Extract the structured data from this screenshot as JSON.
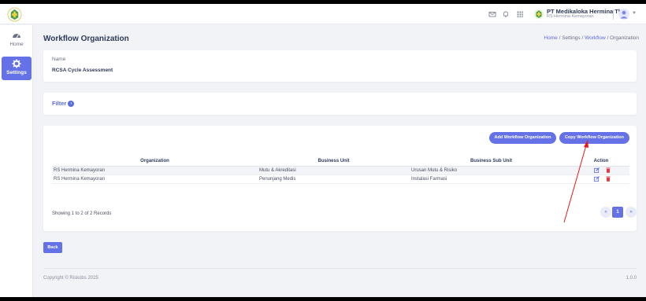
{
  "topbar": {
    "company_name": "PT Medikaloka Hermina Tbk",
    "company_sub": "RS Hermina Kemayoran",
    "icons": [
      "mail-icon",
      "bell-icon",
      "apps-grid-icon",
      "user-avatar-icon"
    ]
  },
  "sidebar": {
    "items": [
      {
        "label": "Home",
        "icon": "dashboard-icon"
      },
      {
        "label": "Settings",
        "icon": "gear-icon",
        "active": true
      }
    ]
  },
  "page": {
    "title": "Workflow Organization",
    "breadcrumb": {
      "home": "Home",
      "sep1": " / ",
      "settings": "Settings",
      "sep2": " / ",
      "workflow": "Workflow",
      "sep3": " / ",
      "current": "Organization"
    }
  },
  "name_card": {
    "label": "Name",
    "value": "RCSA Cycle Assessment"
  },
  "filter": {
    "label": "Filter"
  },
  "buttons": {
    "add": "Add Workflow Organization",
    "copy": "Copy Workflow Organization",
    "back": "Back"
  },
  "table": {
    "headers": {
      "organization": "Organization",
      "business_unit": "Business Unit",
      "business_sub_unit": "Business Sub Unit",
      "action": "Action"
    },
    "rows": [
      {
        "organization": "RS Hermina Kemayoran",
        "business_unit": "Mutu & Akreditasi",
        "business_sub_unit": "Urusan Mutu & Risiko"
      },
      {
        "organization": "RS Hermina Kemayoran",
        "business_unit": "Penunjang Medis",
        "business_sub_unit": "Instalasi Farmasi"
      }
    ],
    "showing": "Showing 1 to 2 of 2 Records"
  },
  "pagination": {
    "prev": "«",
    "current": "1",
    "next": "»"
  },
  "footer": {
    "copyright": "Copyright © Riskobs 2025",
    "version": "1.0.0"
  },
  "colors": {
    "accent": "#6571e6",
    "link": "#5b6be0",
    "delete": "#e53946",
    "annotation": "#e8171b"
  }
}
